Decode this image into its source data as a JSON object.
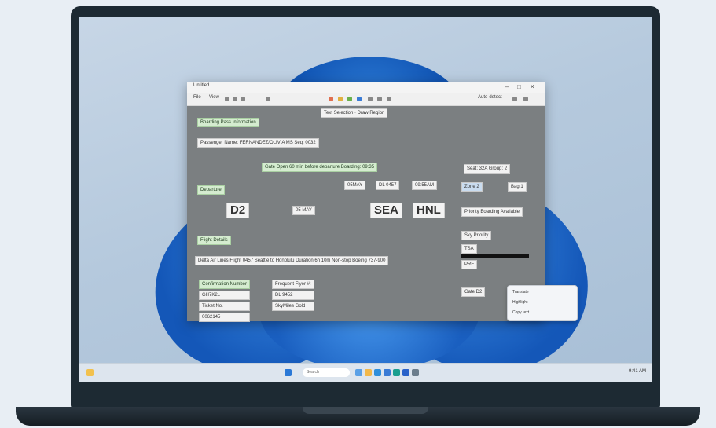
{
  "window": {
    "title": "Untitled",
    "toolbar_items": [
      "File",
      "View"
    ],
    "top_pill": "Text Selection  ·  Draw Region",
    "top_right_label": "Auto-detect"
  },
  "form": {
    "header_green": "Boarding Pass Information",
    "name_line": "Passenger Name: FERNANDEZ/OLIVIA MS   Seq: 0032",
    "notice": "Gate Open 60 min before departure   Boarding: 09:35",
    "seat_label": "Seat: 32A  Group: 2",
    "section_label": "Departure",
    "triple_fields": [
      "05MAY",
      "DL 0457",
      "09:55AM"
    ],
    "gate_code": "D2",
    "date_small": "05 MAY",
    "origin_code": "SEA",
    "destination_code": "HNL",
    "flight_details_label": "Flight Details",
    "flight_line": "Delta Air Lines  Flight 0457  Seattle to Honolulu  Duration 6h 10m  Non-stop  Boeing 737-900",
    "left_block": [
      "Confirmation Number",
      "GH7K2L",
      "Ticket No.",
      "0062145"
    ],
    "right_block": [
      "Frequent Flyer #:",
      "DL 9452",
      "SkyMiles Gold"
    ],
    "side_small_1": "Zone 2",
    "side_small_2": "Bag 1",
    "side_text": "Priority Boarding Available",
    "side_label_2": "Sky Priority",
    "side_small_3": "TSA",
    "side_small_4": "PRE",
    "side_small_5": "Gate D2"
  },
  "popup": {
    "items": [
      "Translate",
      "Highlight",
      "Copy text"
    ]
  },
  "taskbar": {
    "search_placeholder": "Search",
    "clock": "9:41 AM"
  }
}
